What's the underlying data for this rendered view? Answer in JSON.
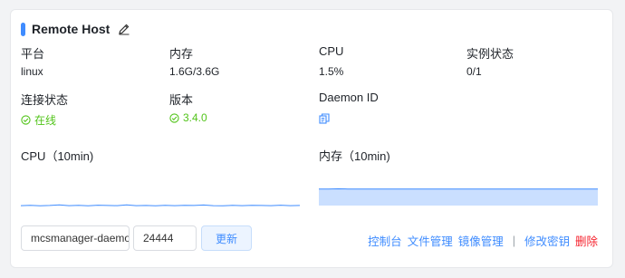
{
  "card": {
    "title": "Remote Host",
    "edit_icon": "pencil-icon"
  },
  "info": {
    "platform_label": "平台",
    "platform_value": "linux",
    "memory_label": "内存",
    "memory_value": "1.6G/3.6G",
    "cpu_label": "CPU",
    "cpu_value": "1.5%",
    "instance_label": "实例状态",
    "instance_value": "0/1",
    "connection_label": "连接状态",
    "connection_value": "在线",
    "version_label": "版本",
    "version_value": "3.4.0",
    "daemon_label": "Daemon ID",
    "copy_icon": "copy-icon"
  },
  "charts": {
    "cpu_title": "CPU（10min)",
    "mem_title": "内存（10min)"
  },
  "chart_data": [
    {
      "type": "line",
      "title": "CPU（10min)",
      "series": [
        {
          "values": [
            1.5,
            1.8,
            1.4,
            1.6,
            2.1,
            1.5,
            1.7,
            1.4,
            1.9,
            1.6,
            1.5,
            2.2,
            1.5,
            1.6,
            1.4,
            1.8,
            1.5,
            1.7,
            1.6,
            2.0,
            1.5,
            1.4,
            1.7,
            1.5,
            1.8,
            1.6,
            1.5,
            1.9,
            1.5,
            1.6
          ]
        }
      ],
      "color": "#3f8cff"
    },
    {
      "type": "area",
      "title": "内存（10min)",
      "series": [
        {
          "values": [
            44,
            44,
            44.5,
            44,
            44,
            44,
            44,
            44,
            44,
            44,
            44,
            44,
            44,
            44,
            44,
            44,
            44,
            44,
            44,
            44,
            44,
            44,
            44,
            44,
            44,
            44,
            44,
            44,
            44,
            44
          ]
        }
      ],
      "color": "#3f8cff"
    }
  ],
  "footer": {
    "host_value": "mcsmanager-daemon",
    "port_value": "24444",
    "update_label": "更新",
    "actions": {
      "console": "控制台",
      "files": "文件管理",
      "images": "镜像管理",
      "separator": "|",
      "change_key": "修改密钥",
      "delete": "删除"
    }
  },
  "colors": {
    "accent": "#3f8cff",
    "online": "#52c41a",
    "danger": "#f5222d"
  }
}
